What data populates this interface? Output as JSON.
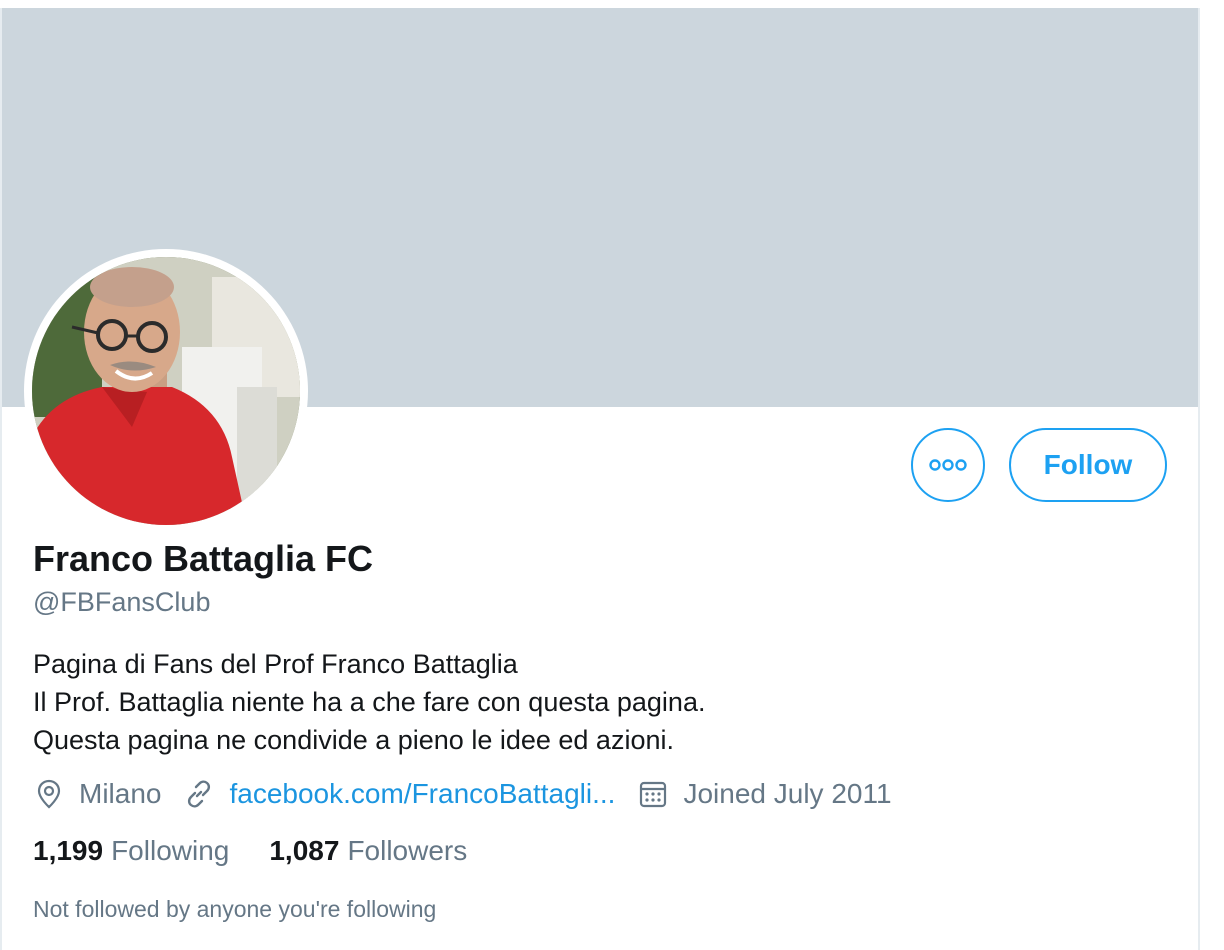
{
  "profile": {
    "display_name": "Franco Battaglia FC",
    "handle": "@FBFansClub",
    "bio_lines": [
      "Pagina di Fans del Prof Franco Battaglia",
      "Il Prof. Battaglia niente ha a che fare con questa pagina.",
      "Questa pagina ne condivide a pieno le idee ed azioni."
    ],
    "location": "Milano",
    "website": "facebook.com/FrancoBattagli...",
    "joined": "Joined July 2011",
    "following_count": "1,199",
    "following_label": "Following",
    "followers_count": "1,087",
    "followers_label": "Followers",
    "followed_by": "Not followed by anyone you're following"
  },
  "actions": {
    "follow_label": "Follow",
    "more_icon": "more-horizontal-icon"
  },
  "icons": {
    "location": "location-pin-icon",
    "link": "link-icon",
    "calendar": "calendar-icon"
  },
  "colors": {
    "accent": "#1da1f2",
    "link": "#1b95e0",
    "banner": "#ccd6dd",
    "secondary_text": "#657786",
    "primary_text": "#14171a"
  }
}
